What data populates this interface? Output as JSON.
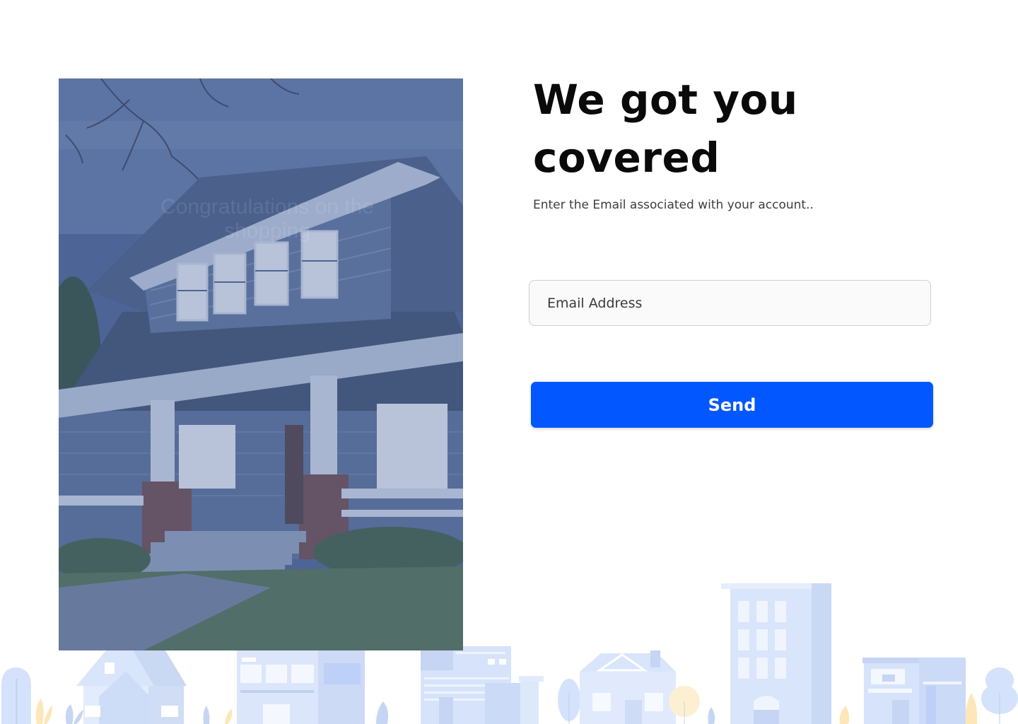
{
  "colors": {
    "accent": "#0357ff",
    "skyline_blue": "#d8e5fb",
    "photo_tint": "#4a5f8a"
  },
  "hero_image": {
    "icon": "house-photo",
    "overlay_text": "Congratulations on the shopping"
  },
  "form": {
    "heading": "We got you covered",
    "subtitle": "Enter the Email associated with your account..",
    "email_placeholder": "Email Address",
    "email_value": "",
    "send_label": "Send"
  },
  "background": {
    "icon": "city-skyline-illustration"
  }
}
